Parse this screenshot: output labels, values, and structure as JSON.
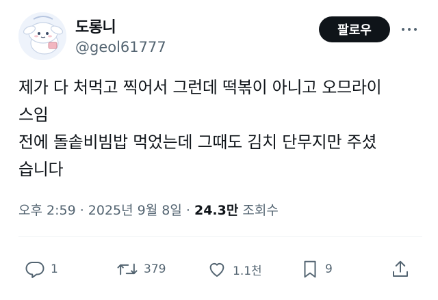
{
  "user": {
    "display_name": "도롱니",
    "handle": "@geol61777",
    "follow_label": "팔로우"
  },
  "tweet": {
    "lines": [
      "제가 다 처먹고 찍어서 그런데 떡볶이 아니고 오므라이",
      "스임",
      "전에 돌솥비빔밥 먹었는데 그때도 김치 단무지만 주셨",
      "습니다"
    ]
  },
  "meta": {
    "time": "오후 2:59",
    "sep1": " · ",
    "date": "2025년 9월 8일",
    "sep2": " · ",
    "views": "24.3만",
    "views_label": " 조회수"
  },
  "actions": {
    "reply_count": "1",
    "retweet_count": "379",
    "like_count": "1.1천",
    "bookmark_count": "9"
  },
  "icons": [
    "avatar",
    "more-icon",
    "reply-icon",
    "retweet-icon",
    "like-icon",
    "bookmark-icon",
    "share-icon"
  ]
}
